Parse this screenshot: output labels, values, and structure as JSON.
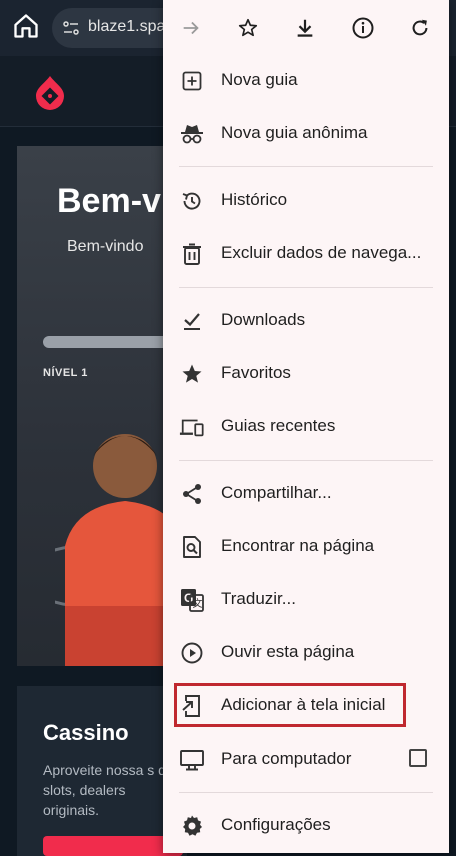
{
  "browser": {
    "url_text": "blaze1.spa",
    "menu": {
      "toolbar": [
        "forward-icon",
        "star-icon",
        "download-icon",
        "info-icon",
        "refresh-icon"
      ],
      "items": [
        {
          "label": "Nova guia",
          "icon": "new-tab-icon"
        },
        {
          "label": "Nova guia anônima",
          "icon": "incognito-icon"
        },
        {
          "label": "Histórico",
          "icon": "history-icon"
        },
        {
          "label": "Excluir dados de navega...",
          "icon": "trash-icon"
        },
        {
          "label": "Downloads",
          "icon": "download-done-icon"
        },
        {
          "label": "Favoritos",
          "icon": "star-filled-icon"
        },
        {
          "label": "Guias recentes",
          "icon": "devices-icon"
        },
        {
          "label": "Compartilhar...",
          "icon": "share-icon"
        },
        {
          "label": "Encontrar na página",
          "icon": "find-in-page-icon"
        },
        {
          "label": "Traduzir...",
          "icon": "translate-icon"
        },
        {
          "label": "Ouvir esta página",
          "icon": "play-circle-icon"
        },
        {
          "label": "Adicionar à tela inicial",
          "icon": "add-to-home-icon"
        },
        {
          "label": "Para computador",
          "icon": "desktop-icon",
          "checked": false
        },
        {
          "label": "Configurações",
          "icon": "settings-icon"
        }
      ],
      "highlight_color": "#c0282f"
    }
  },
  "page": {
    "hero_title": "Bem-v",
    "hero_subtitle": "Bem-vindo",
    "level_label": "NÍVEL 1",
    "casino_title": "Cassino",
    "casino_desc": "Aproveite nossa s de slots, dealers originais.",
    "accent": "#f12c4c"
  }
}
